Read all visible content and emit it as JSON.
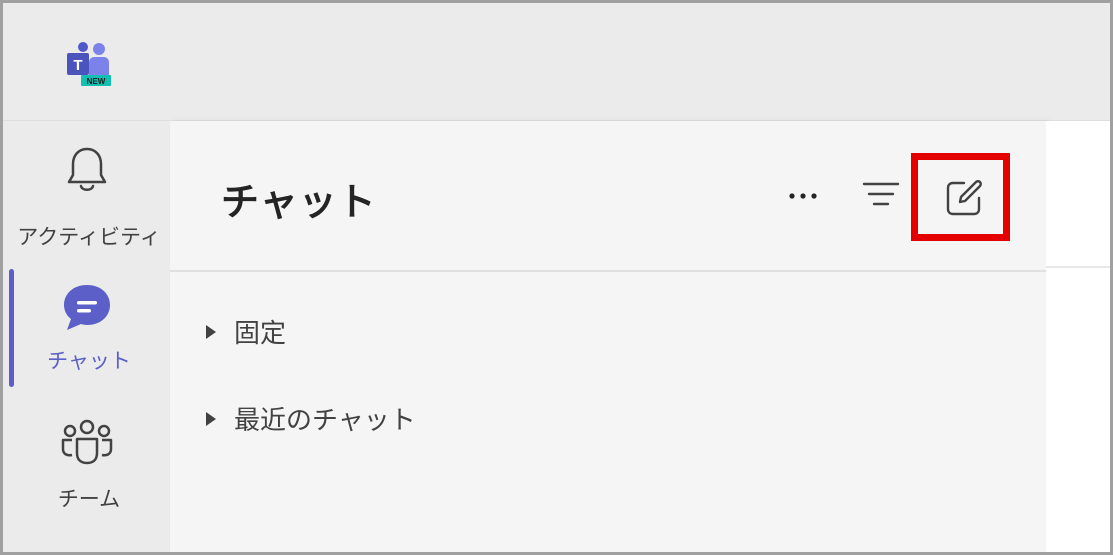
{
  "app": {
    "logo_icon": "teams-new-logo-icon",
    "logo_badge": "NEW"
  },
  "rail": {
    "items": [
      {
        "label": "アクティビティ",
        "icon": "bell-icon"
      },
      {
        "label": "チャット",
        "icon": "chat-icon"
      },
      {
        "label": "チーム",
        "icon": "teams-people-icon"
      }
    ],
    "active_index": 1
  },
  "chat_pane": {
    "title": "チャット",
    "more_icon": "more-horizontal-icon",
    "filter_icon": "filter-icon",
    "new_chat_icon": "compose-icon",
    "sections": [
      {
        "label": "固定"
      },
      {
        "label": "最近のチャット"
      }
    ]
  },
  "colors": {
    "accent": "#5b5fc7",
    "highlight": "#e50000"
  }
}
